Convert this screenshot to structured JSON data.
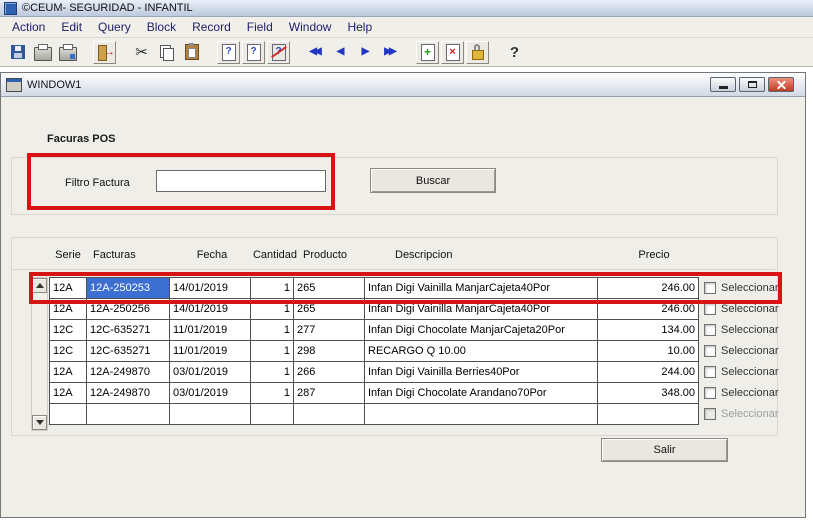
{
  "app": {
    "title": "©CEUM- SEGURIDAD - INFANTIL",
    "menu": [
      "Action",
      "Edit",
      "Query",
      "Block",
      "Record",
      "Field",
      "Window",
      "Help"
    ]
  },
  "toolbar": {
    "glyphs": {
      "cut": "✂",
      "exit": "→",
      "query": "?",
      "first": "◀◀",
      "prev": "◀",
      "next": "▶",
      "last": "▶▶",
      "insert": "+",
      "remove": "×",
      "help": "?"
    }
  },
  "window": {
    "title": "WINDOW1",
    "section_title": "Facuras POS",
    "filter_label": "Filtro Factura",
    "filter_value": "",
    "buscar_label": "Buscar",
    "salir_label": "Salir"
  },
  "table": {
    "headers": [
      "Serie",
      "Facturas",
      "Fecha",
      "Cantidad",
      "Producto",
      "Descripcion",
      "Precio"
    ],
    "select_label": "Seleccionar",
    "rows": [
      {
        "serie": "12A",
        "factura": "12A-250253",
        "fecha": "14/01/2019",
        "cantidad": "1",
        "producto": "265",
        "descripcion": "Infan Digi Vainilla ManjarCajeta40Por",
        "precio": "246.00"
      },
      {
        "serie": "12A",
        "factura": "12A-250256",
        "fecha": "14/01/2019",
        "cantidad": "1",
        "producto": "265",
        "descripcion": "Infan Digi Vainilla ManjarCajeta40Por",
        "precio": "246.00"
      },
      {
        "serie": "12C",
        "factura": "12C-635271",
        "fecha": "11/01/2019",
        "cantidad": "1",
        "producto": "277",
        "descripcion": "Infan Digi Chocolate ManjarCajeta20Por",
        "precio": "134.00"
      },
      {
        "serie": "12C",
        "factura": "12C-635271",
        "fecha": "11/01/2019",
        "cantidad": "1",
        "producto": "298",
        "descripcion": "RECARGO Q 10.00",
        "precio": "10.00"
      },
      {
        "serie": "12A",
        "factura": "12A-249870",
        "fecha": "03/01/2019",
        "cantidad": "1",
        "producto": "266",
        "descripcion": "Infan Digi Vainilla Berries40Por",
        "precio": "244.00"
      },
      {
        "serie": "12A",
        "factura": "12A-249870",
        "fecha": "03/01/2019",
        "cantidad": "1",
        "producto": "287",
        "descripcion": "Infan Digi Chocolate Arandano70Por",
        "precio": "348.00"
      },
      {
        "serie": "",
        "factura": "",
        "fecha": "",
        "cantidad": "",
        "producto": "",
        "descripcion": "",
        "precio": ""
      }
    ]
  },
  "colors": {
    "annotation": "#d61414",
    "selection": "#3d6fd2"
  }
}
